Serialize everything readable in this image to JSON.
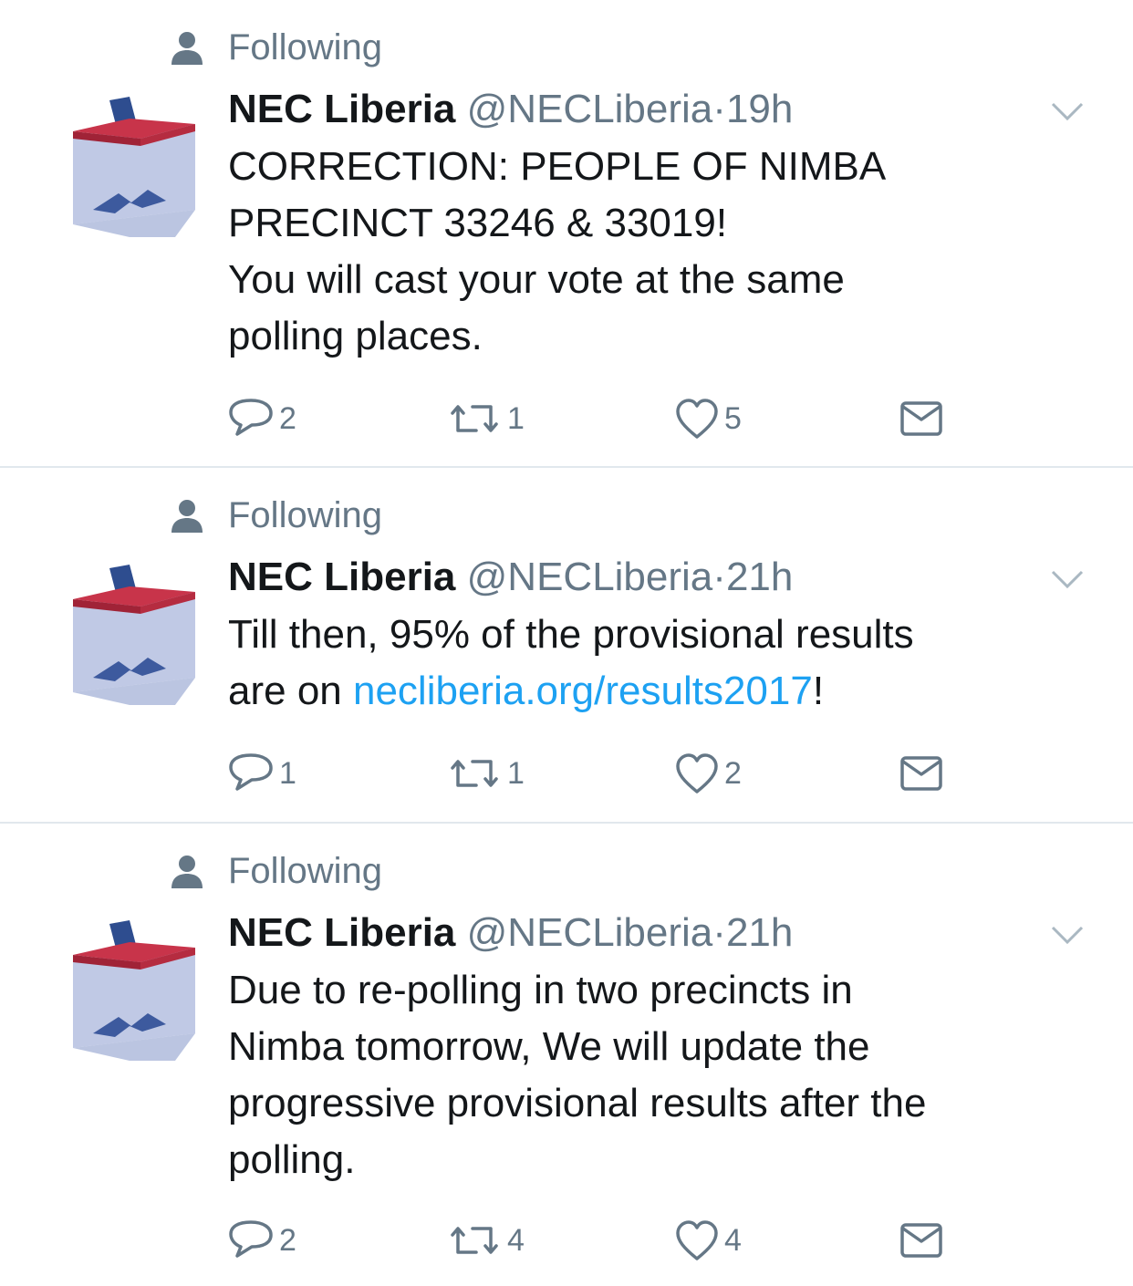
{
  "tweets": [
    {
      "context": "Following",
      "name": "NEC Liberia",
      "handle": "@NECLiberia",
      "separator": "·",
      "time": "19h",
      "lines": [
        {
          "text": "CORRECTION:  PEOPLE OF NIMBA"
        },
        {
          "text": "PRECINCT 33246 & 33019!"
        },
        {
          "text": "You will cast your vote at the same"
        },
        {
          "text": "polling places."
        }
      ],
      "replies": "2",
      "retweets": "1",
      "likes": "5"
    },
    {
      "context": "Following",
      "name": "NEC Liberia",
      "handle": "@NECLiberia",
      "separator": "·",
      "time": "21h",
      "lines": [
        {
          "text": "Till then, 95% of the provisional results"
        },
        {
          "pre": "are on ",
          "link": "necliberia.org/results2017",
          "post": "!"
        }
      ],
      "replies": "1",
      "retweets": "1",
      "likes": "2"
    },
    {
      "context": "Following",
      "name": "NEC Liberia",
      "handle": "@NECLiberia",
      "separator": "·",
      "time": "21h",
      "lines": [
        {
          "text": "Due to re-polling in two precincts in"
        },
        {
          "text": "Nimba tomorrow, We will update the"
        },
        {
          "text": "progressive provisional results after the"
        },
        {
          "text": "polling."
        }
      ],
      "replies": "2",
      "retweets": "4",
      "likes": "4"
    }
  ],
  "icons": {
    "context": "person-icon",
    "avatar": "ballot-box-avatar",
    "caret": "chevron-down-icon",
    "reply": "reply-icon",
    "retweet": "retweet-icon",
    "like": "heart-icon",
    "dm": "envelope-icon"
  },
  "colors": {
    "text": "#14171a",
    "secondary": "#657786",
    "link": "#1da1f2",
    "divider": "#e1e8ed",
    "ballot_lid": "#c8344a",
    "ballot_box": "#b7c2e0"
  }
}
